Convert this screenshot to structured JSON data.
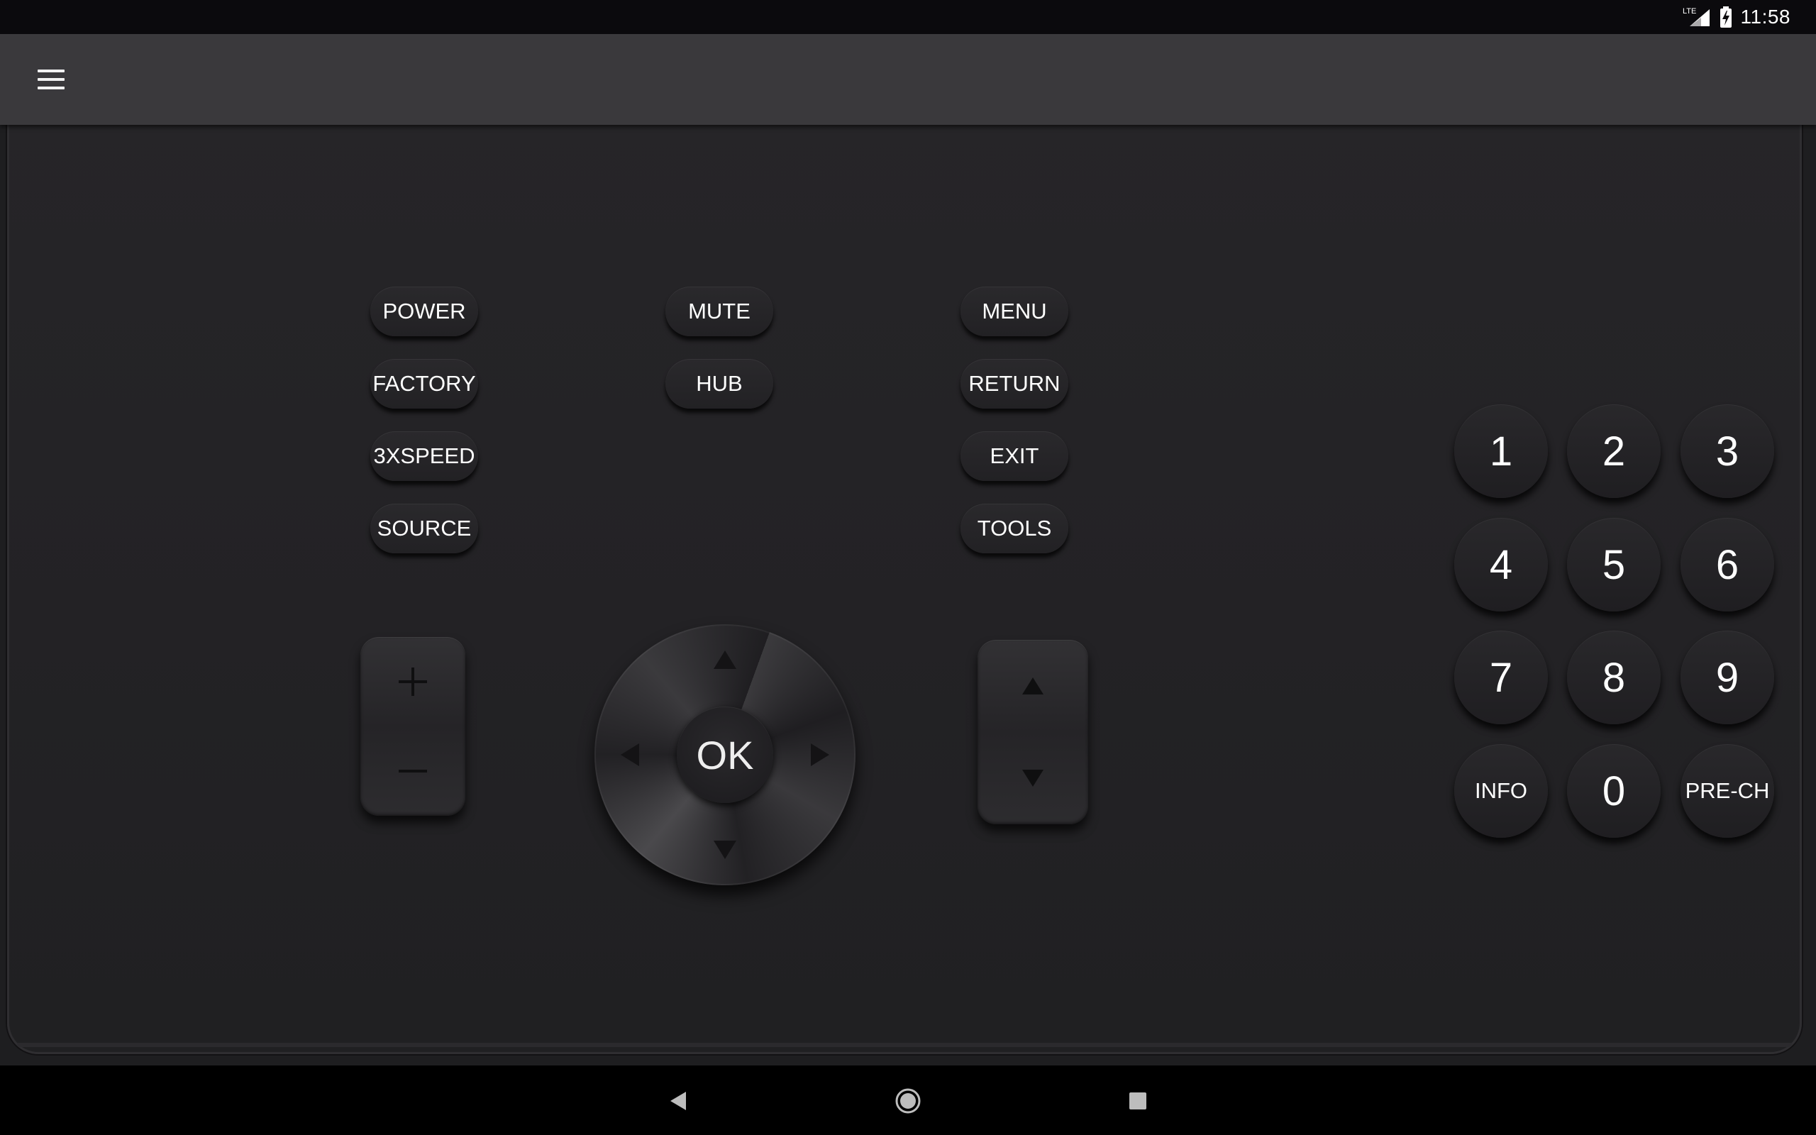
{
  "status_bar": {
    "network": "LTE",
    "time": "11:58"
  },
  "app_bar": {
    "menu_icon": "hamburger-menu-icon"
  },
  "remote": {
    "left_column": [
      "POWER",
      "FACTORY",
      "3XSPEED",
      "SOURCE"
    ],
    "middle_column": [
      "MUTE",
      "HUB"
    ],
    "right_column": [
      "MENU",
      "RETURN",
      "EXIT",
      "TOOLS"
    ],
    "volume": {
      "up_icon": "plus-icon",
      "down_icon": "minus-icon"
    },
    "dpad": {
      "ok_label": "OK"
    },
    "channel": {
      "up_icon": "triangle-up-icon",
      "down_icon": "triangle-down-icon"
    },
    "keypad": [
      "1",
      "2",
      "3",
      "4",
      "5",
      "6",
      "7",
      "8",
      "9",
      "INFO",
      "0",
      "PRE-CH"
    ]
  },
  "nav_bar": {
    "back_icon": "back-icon",
    "home_icon": "home-icon",
    "recents_icon": "recents-icon"
  }
}
